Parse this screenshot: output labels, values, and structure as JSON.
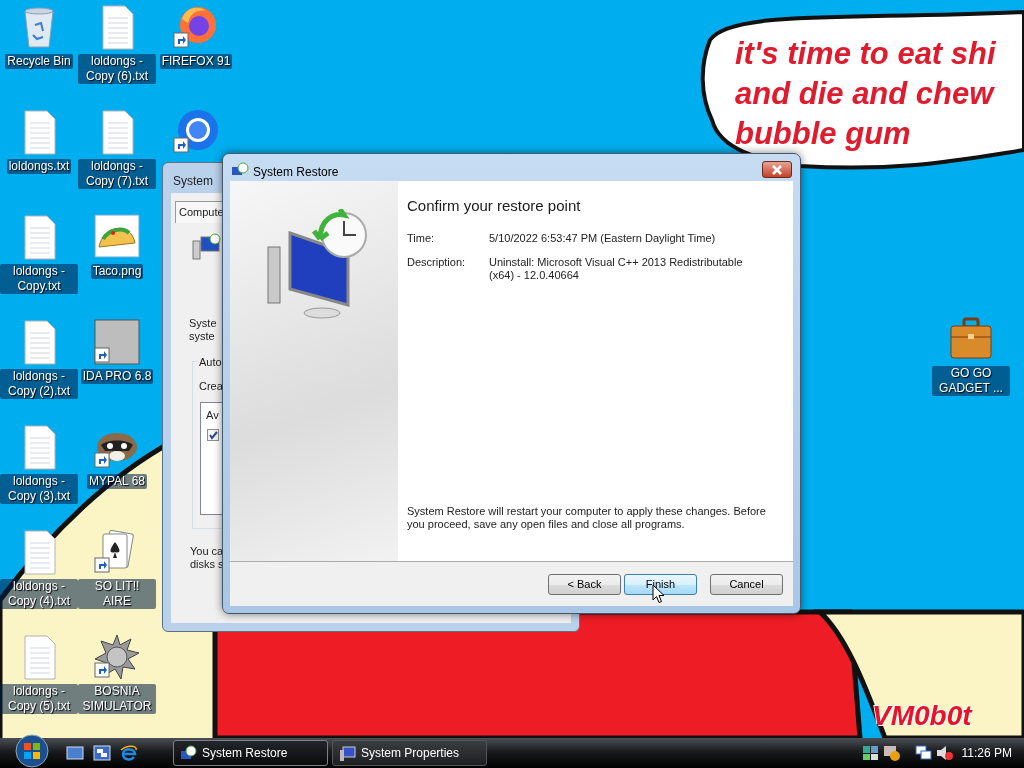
{
  "wallpaper": {
    "bubble_lines": [
      "it's time to eat shi",
      "and die and chew",
      "bubble gum"
    ],
    "signature": "VM0b0t"
  },
  "desktop_icons": [
    {
      "label": "Recycle Bin",
      "kind": "recycle",
      "shortcut": false
    },
    {
      "label": "loldongs.txt",
      "kind": "text",
      "shortcut": false
    },
    {
      "label": "loldongs - Copy.txt",
      "kind": "text",
      "shortcut": false
    },
    {
      "label": "loldongs - Copy (2).txt",
      "kind": "text",
      "shortcut": false
    },
    {
      "label": "loldongs - Copy (3).txt",
      "kind": "text",
      "shortcut": false
    },
    {
      "label": "loldongs - Copy (4).txt",
      "kind": "text",
      "shortcut": false
    },
    {
      "label": "loldongs - Copy (5).txt",
      "kind": "text",
      "shortcut": false
    },
    {
      "label": "loldongs - Copy (6).txt",
      "kind": "text",
      "shortcut": false
    },
    {
      "label": "loldongs - Copy (7).txt",
      "kind": "text",
      "shortcut": false
    },
    {
      "label": "Taco.png",
      "kind": "taco",
      "shortcut": false
    },
    {
      "label": "IDA PRO 6.8",
      "kind": "portrait",
      "shortcut": true
    },
    {
      "label": "MYPAL 68",
      "kind": "raccoon",
      "shortcut": true
    },
    {
      "label": "SO LIT!! AIRE",
      "kind": "cards",
      "shortcut": true
    },
    {
      "label": "BOSNIA SIMULATOR",
      "kind": "mine",
      "shortcut": true
    },
    {
      "label": "FIREFOX 91",
      "kind": "firefox",
      "shortcut": true
    },
    {
      "kind": "chrome",
      "shortcut": true
    },
    {
      "label": "GO GO GADGET ...",
      "kind": "briefcase",
      "shortcut": false
    }
  ],
  "background_window": {
    "title": "System",
    "tab": "Compute",
    "intro_lines": [
      "Syste",
      "syste"
    ],
    "group_label": "Auto",
    "group_text": "Crea",
    "list_header": "Av",
    "checked": true,
    "footer_lines": [
      "You ca",
      "disks s"
    ]
  },
  "dialog": {
    "title": "System Restore",
    "heading": "Confirm your restore point",
    "fields": [
      {
        "label": "Time:",
        "value": "5/10/2022 6:53:47 PM (Eastern Daylight Time)"
      },
      {
        "label": "Description:",
        "value": "Uninstall: Microsoft Visual C++ 2013 Redistributable (x64) - 12.0.40664"
      }
    ],
    "notice": "System Restore will restart your computer to apply these changes. Before you proceed, save any open files and close all programs.",
    "buttons": [
      {
        "label": "< Back",
        "default": false
      },
      {
        "label": "Finish",
        "default": true
      },
      {
        "label": "Cancel",
        "default": false
      }
    ]
  },
  "taskbar": {
    "tasks": [
      {
        "label": "System Restore",
        "kind": "restore",
        "selected": true
      },
      {
        "label": "System Properties",
        "kind": "properties",
        "selected": false
      }
    ],
    "clock": "11:26 PM"
  }
}
